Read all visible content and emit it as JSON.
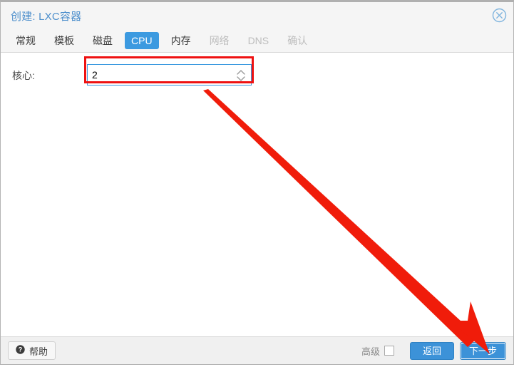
{
  "window": {
    "title": "创建: LXC容器",
    "close_icon": "close-circle-icon"
  },
  "tabs": [
    {
      "label": "常规",
      "state": "enabled"
    },
    {
      "label": "模板",
      "state": "enabled"
    },
    {
      "label": "磁盘",
      "state": "enabled"
    },
    {
      "label": "CPU",
      "state": "active"
    },
    {
      "label": "内存",
      "state": "enabled"
    },
    {
      "label": "网络",
      "state": "disabled"
    },
    {
      "label": "DNS",
      "state": "disabled"
    },
    {
      "label": "确认",
      "state": "disabled"
    }
  ],
  "form": {
    "cores": {
      "label": "核心:",
      "value": "2",
      "placeholder": "",
      "spinner_icon": "spinner-updown-icon"
    }
  },
  "footer": {
    "help_label": "帮助",
    "help_icon": "question-circle-icon",
    "advanced_label": "高级",
    "advanced_checked": false,
    "back_label": "返回",
    "next_label": "下一步"
  },
  "annotations": {
    "highlight_color": "#ee1111",
    "arrow_color": "#f01c0a",
    "arrow_target": "下一步",
    "highlight_target": "核心"
  },
  "colors": {
    "accent": "#3c9ae0",
    "title_text": "#4d8fcc",
    "button": "#3c92d8",
    "disabled_text": "#bdbdbd"
  }
}
